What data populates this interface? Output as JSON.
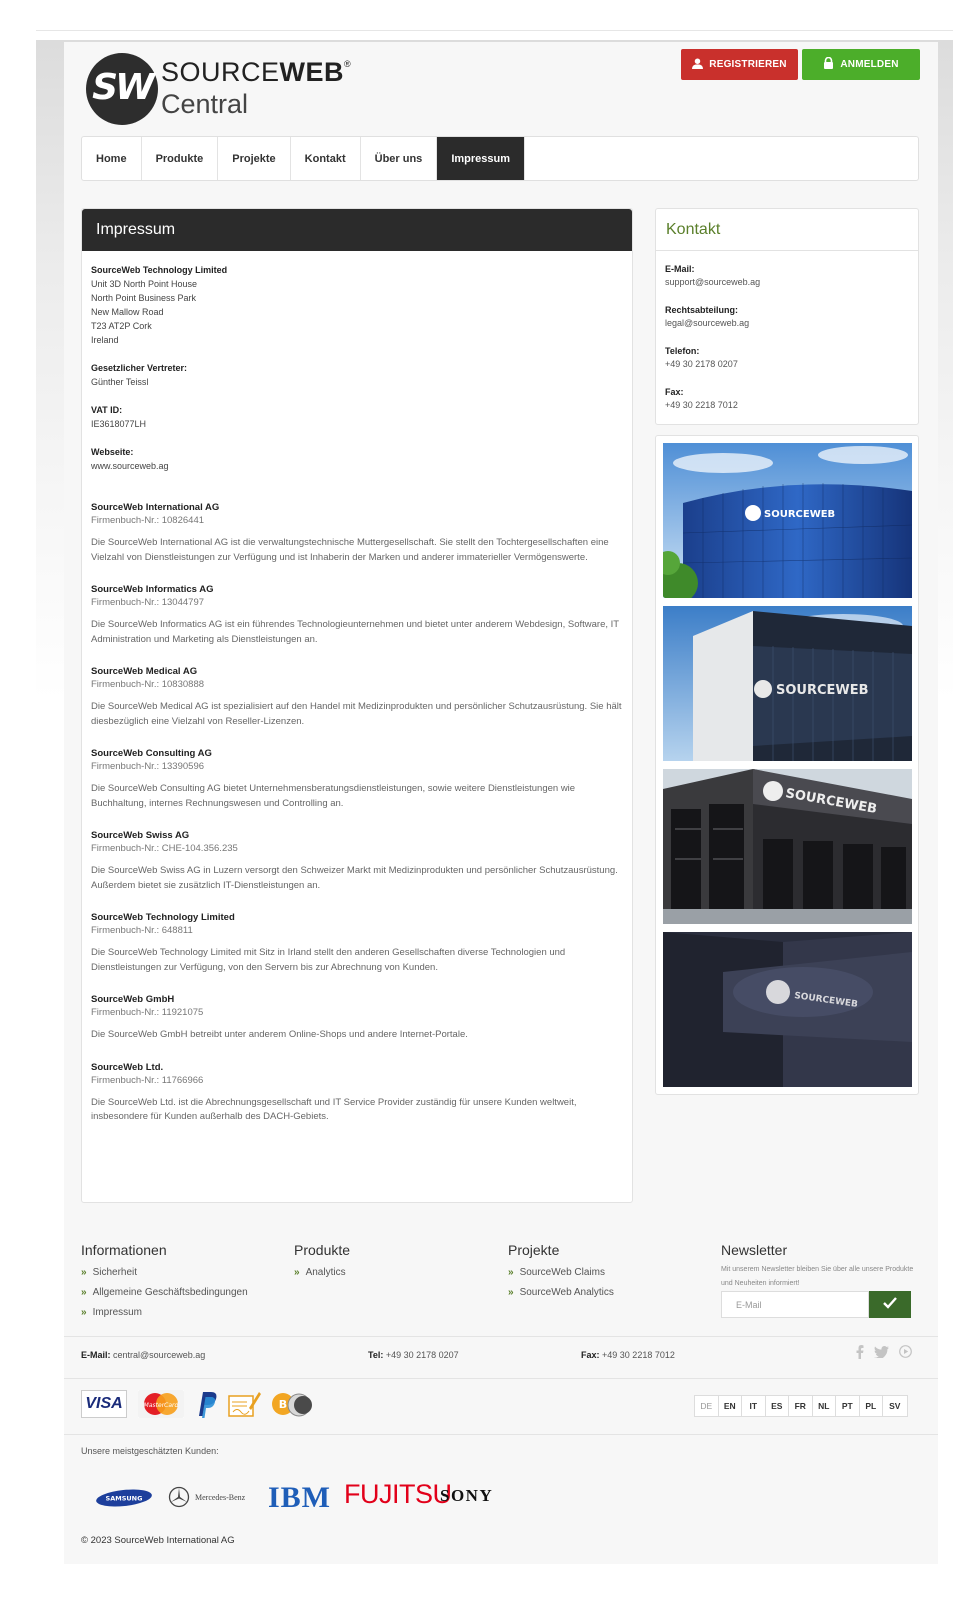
{
  "header": {
    "logo_monogram": "SW",
    "brand_line1_a": "SOURCE",
    "brand_line1_b": "WEB",
    "brand_reg": "®",
    "brand_line2": "Central",
    "register_label": "REGISTRIEREN",
    "login_label": "ANMELDEN",
    "register_color": "#c9302c",
    "login_color": "#4cae2a"
  },
  "nav": {
    "items": [
      "Home",
      "Produkte",
      "Projekte",
      "Kontakt",
      "Über uns",
      "Impressum"
    ],
    "active": "Impressum"
  },
  "main": {
    "title": "Impressum",
    "entity_name": "SourceWeb Technology Limited",
    "address": [
      "Unit 3D North Point House",
      "North Point Business Park",
      "New Mallow Road",
      "T23 AT2P Cork",
      "Ireland"
    ],
    "rep_label": "Gesetzlicher Vertreter:",
    "rep_value": "Günther Teissl",
    "vat_label": "VAT ID:",
    "vat_value": "IE3618077LH",
    "web_label": "Webseite:",
    "web_value": "www.sourceweb.ag",
    "companies": [
      {
        "name": "SourceWeb International AG",
        "reg": "Firmenbuch-Nr.: 10826441",
        "desc": "Die SourceWeb International AG ist die verwaltungstechnische Muttergesellschaft. Sie stellt den Tochtergesellschaften eine Vielzahl von Dienstleistungen zur Verfügung und ist Inhaberin der Marken und anderer immaterieller Vermögenswerte."
      },
      {
        "name": "SourceWeb Informatics AG",
        "reg": "Firmenbuch-Nr.: 13044797",
        "desc": "Die SourceWeb Informatics AG ist ein führendes Technologieunternehmen und bietet unter anderem Webdesign, Software, IT Administration und Marketing als Dienstleistungen an."
      },
      {
        "name": "SourceWeb Medical AG",
        "reg": "Firmenbuch-Nr.: 10830888",
        "desc": "Die SourceWeb Medical AG ist spezialisiert auf den Handel mit Medizinprodukten und persönlicher Schutzausrüstung. Sie hält diesbezüglich eine Vielzahl von Reseller-Lizenzen."
      },
      {
        "name": "SourceWeb Consulting AG",
        "reg": "Firmenbuch-Nr.: 13390596",
        "desc": "Die SourceWeb Consulting AG bietet Unternehmensberatungsdienstleistungen, sowie weitere Dienstleistungen wie Buchhaltung, internes Rechnungswesen und Controlling an."
      },
      {
        "name": "SourceWeb Swiss AG",
        "reg": "Firmenbuch-Nr.: CHE-104.356.235",
        "desc": "Die SourceWeb Swiss AG in Luzern versorgt den Schweizer Markt mit Medizinprodukten und persönlicher Schutzausrüstung. Außerdem bietet sie zusätzlich IT-Dienstleistungen an."
      },
      {
        "name": "SourceWeb Technology Limited",
        "reg": "Firmenbuch-Nr.: 648811",
        "desc": "Die SourceWeb Technology Limited mit Sitz in Irland stellt den anderen Gesellschaften diverse Technologien und Dienstleistungen zur Verfügung, von den Servern bis zur Abrechnung von Kunden."
      },
      {
        "name": "SourceWeb GmbH",
        "reg": "Firmenbuch-Nr.: 11921075",
        "desc": "Die SourceWeb GmbH betreibt unter anderem Online-Shops und andere Internet-Portale."
      },
      {
        "name": "SourceWeb Ltd.",
        "reg": "Firmenbuch-Nr.: 11766966",
        "desc": "Die SourceWeb Ltd. ist die Abrechnungsgesellschaft und IT Service Provider zuständig für unsere Kunden weltweit, insbesondere für Kunden außerhalb des DACH-Gebiets."
      }
    ]
  },
  "sidebar": {
    "title": "Kontakt",
    "email_label": "E-Mail:",
    "email_value": "support@sourceweb.ag",
    "legal_label": "Rechtsabteilung:",
    "legal_value": "legal@sourceweb.ag",
    "phone_label": "Telefon:",
    "phone_value": "+49 30 2178 0207",
    "fax_label": "Fax:",
    "fax_value": "+49 30 2218 7012",
    "photo_sign": "SOURCEWEB"
  },
  "footer": {
    "info_title": "Informationen",
    "info_links": [
      "Sicherheit",
      "Allgemeine Geschäftsbedingungen",
      "Impressum"
    ],
    "products_title": "Produkte",
    "products_links": [
      "Analytics"
    ],
    "projects_title": "Projekte",
    "projects_links": [
      "SourceWeb Claims",
      "SourceWeb Analytics"
    ],
    "newsletter_title": "Newsletter",
    "newsletter_text": "Mit unserem Newsletter bleiben Sie über alle unsere Produkte und Neuheiten informiert!",
    "newsletter_placeholder": "E-Mail",
    "email_label": "E-Mail:",
    "email_value": "central@sourceweb.ag",
    "tel_label": "Tel:",
    "tel_value": "+49 30 2178 0207",
    "fax_label": "Fax:",
    "fax_value": "+49 30 2218 7012",
    "languages": [
      "DE",
      "EN",
      "IT",
      "ES",
      "FR",
      "NL",
      "PT",
      "PL",
      "SV"
    ],
    "customers_label": "Unsere meistgeschätzten Kunden:",
    "customers": [
      "SAMSUNG",
      "Mercedes-Benz",
      "IBM",
      "FUJITSU",
      "SONY"
    ],
    "payment_visa": "VISA",
    "payment_mc": "MasterCard",
    "copyright": "© 2023 SourceWeb International AG"
  }
}
